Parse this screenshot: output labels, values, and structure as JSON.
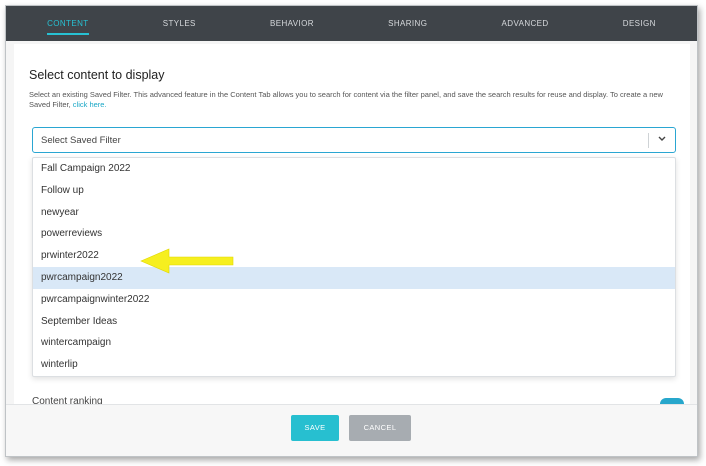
{
  "tabs": [
    {
      "label": "CONTENT",
      "active": true
    },
    {
      "label": "STYLES",
      "active": false
    },
    {
      "label": "BEHAVIOR",
      "active": false
    },
    {
      "label": "SHARING",
      "active": false
    },
    {
      "label": "ADVANCED",
      "active": false
    },
    {
      "label": "DESIGN",
      "active": false
    }
  ],
  "section": {
    "heading": "Select content to display",
    "description": "Select an existing Saved Filter. This advanced feature in the Content Tab allows you to search for content via the filter panel, and save the search results for reuse and display. To create a new Saved Filter,",
    "link_text": "click here."
  },
  "select": {
    "placeholder": "Select Saved Filter",
    "chevron_icon": "chevron-down-icon"
  },
  "dropdown": {
    "options": [
      "Fall Campaign 2022",
      "Follow up",
      "newyear",
      "powerreviews",
      "prwinter2022",
      "pwrcampaign2022",
      "pwrcampaignwinter2022",
      "September Ideas",
      "wintercampaign",
      "winterlip"
    ],
    "highlighted": "pwrcampaign2022"
  },
  "background": {
    "partial_label": "Content ranking"
  },
  "footer": {
    "save_label": "SAVE",
    "cancel_label": "CANCEL"
  },
  "colors": {
    "accent": "#27c1d3",
    "nav_bg": "#3f4449",
    "highlight": "#d9e8f7",
    "arrow": "#f6ef1f",
    "cancel": "#a7acb1"
  }
}
